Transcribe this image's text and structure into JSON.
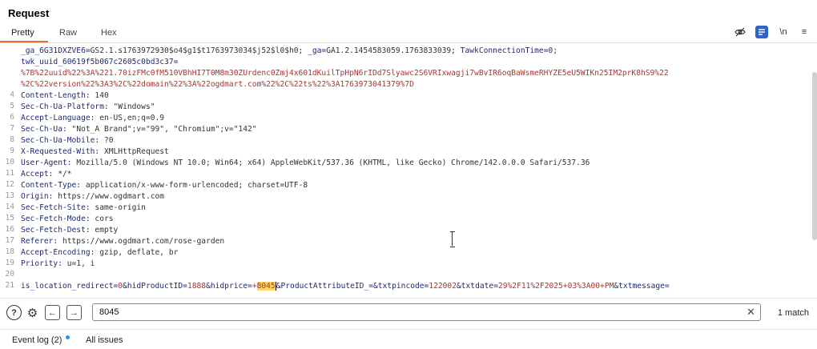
{
  "panel": {
    "title": "Request"
  },
  "tabs": [
    "Pretty",
    "Raw",
    "Hex"
  ],
  "toolbar": {
    "newline_label": "\\n",
    "menu_label": "≡"
  },
  "editor": {
    "lines": [
      {
        "num": "",
        "segments": [
          {
            "cls": "cookie-name",
            "t": "_ga_6G31DXZVE6="
          },
          {
            "cls": "hdr-value",
            "t": "GS2.1.s1763972930$o4$g1$t1763973034$j52$l0$h0; "
          },
          {
            "cls": "cookie-name",
            "t": "_ga="
          },
          {
            "cls": "hdr-value",
            "t": "GA1.2.1454583059.1763833039; "
          },
          {
            "cls": "cookie-name",
            "t": "TawkConnectionTime="
          },
          {
            "cls": "hdr-value",
            "t": "0;"
          }
        ]
      },
      {
        "num": "",
        "segments": [
          {
            "cls": "cookie-name",
            "t": "twk_uuid_60619f5b067c2605c0bd3c37="
          }
        ]
      },
      {
        "num": "",
        "segments": [
          {
            "cls": "cookie-val",
            "t": "%7B%22uuid%22%3A%221.70izFMc0fM510VBhHI7T0M8m30ZUrdenc0Zmj4x601dKuilTpHpN6rIDd7Slyawc2S6VRIxwagji7wBvIR6oqBaWsmeRHYZE5eU5WIKn25IM2prK8hS9%22"
          }
        ]
      },
      {
        "num": "",
        "segments": [
          {
            "cls": "cookie-val",
            "t": "%2C%22version%22%3A3%2C%22domain%22%3A%22ogdmart.com%22%2C%22ts%22%3A1763973041379%7D"
          }
        ]
      },
      {
        "num": "4",
        "segments": [
          {
            "cls": "hdr-name",
            "t": "Content-Length: "
          },
          {
            "cls": "hdr-value",
            "t": "140"
          }
        ]
      },
      {
        "num": "5",
        "segments": [
          {
            "cls": "hdr-name",
            "t": "Sec-Ch-Ua-Platform: "
          },
          {
            "cls": "hdr-value",
            "t": "\"Windows\""
          }
        ]
      },
      {
        "num": "6",
        "segments": [
          {
            "cls": "hdr-name",
            "t": "Accept-Language: "
          },
          {
            "cls": "hdr-value",
            "t": "en-US,en;q=0.9"
          }
        ]
      },
      {
        "num": "7",
        "segments": [
          {
            "cls": "hdr-name",
            "t": "Sec-Ch-Ua: "
          },
          {
            "cls": "hdr-value",
            "t": "\"Not_A Brand\";v=\"99\", \"Chromium\";v=\"142\""
          }
        ]
      },
      {
        "num": "8",
        "segments": [
          {
            "cls": "hdr-name",
            "t": "Sec-Ch-Ua-Mobile: "
          },
          {
            "cls": "hdr-value",
            "t": "?0"
          }
        ]
      },
      {
        "num": "9",
        "segments": [
          {
            "cls": "hdr-name",
            "t": "X-Requested-With: "
          },
          {
            "cls": "hdr-value",
            "t": "XMLHttpRequest"
          }
        ]
      },
      {
        "num": "10",
        "segments": [
          {
            "cls": "hdr-name",
            "t": "User-Agent: "
          },
          {
            "cls": "hdr-value",
            "t": "Mozilla/5.0 (Windows NT 10.0; Win64; x64) AppleWebKit/537.36 (KHTML, like Gecko) Chrome/142.0.0.0 Safari/537.36"
          }
        ]
      },
      {
        "num": "11",
        "segments": [
          {
            "cls": "hdr-name",
            "t": "Accept: "
          },
          {
            "cls": "hdr-value",
            "t": "*/*"
          }
        ]
      },
      {
        "num": "12",
        "segments": [
          {
            "cls": "hdr-name",
            "t": "Content-Type: "
          },
          {
            "cls": "hdr-value",
            "t": "application/x-www-form-urlencoded; charset=UTF-8"
          }
        ]
      },
      {
        "num": "13",
        "segments": [
          {
            "cls": "hdr-name",
            "t": "Origin: "
          },
          {
            "cls": "hdr-value",
            "t": "https://www.ogdmart.com"
          }
        ]
      },
      {
        "num": "14",
        "segments": [
          {
            "cls": "hdr-name",
            "t": "Sec-Fetch-Site: "
          },
          {
            "cls": "hdr-value",
            "t": "same-origin"
          }
        ]
      },
      {
        "num": "15",
        "segments": [
          {
            "cls": "hdr-name",
            "t": "Sec-Fetch-Mode: "
          },
          {
            "cls": "hdr-value",
            "t": "cors"
          }
        ]
      },
      {
        "num": "16",
        "segments": [
          {
            "cls": "hdr-name",
            "t": "Sec-Fetch-Dest: "
          },
          {
            "cls": "hdr-value",
            "t": "empty"
          }
        ]
      },
      {
        "num": "17",
        "segments": [
          {
            "cls": "hdr-name",
            "t": "Referer: "
          },
          {
            "cls": "hdr-value",
            "t": "https://www.ogdmart.com/rose-garden"
          }
        ]
      },
      {
        "num": "18",
        "segments": [
          {
            "cls": "hdr-name",
            "t": "Accept-Encoding: "
          },
          {
            "cls": "hdr-value",
            "t": "gzip, deflate, br"
          }
        ]
      },
      {
        "num": "19",
        "segments": [
          {
            "cls": "hdr-name",
            "t": "Priority: "
          },
          {
            "cls": "hdr-value",
            "t": "u=1, i"
          }
        ]
      },
      {
        "num": "20",
        "segments": []
      },
      {
        "num": "21",
        "segments": [
          {
            "cls": "body-key",
            "t": "is_location_redirect="
          },
          {
            "cls": "body-val",
            "t": "0"
          },
          {
            "cls": "body-key",
            "t": "&hidProductID="
          },
          {
            "cls": "body-val",
            "t": "1888"
          },
          {
            "cls": "body-key",
            "t": "&hidprice="
          },
          {
            "cls": "body-val",
            "t": "+"
          },
          {
            "cls": "hl",
            "t": "8045"
          },
          {
            "cls": "body-key caret-mark",
            "t": "&ProductAttributeID_="
          },
          {
            "cls": "body-key",
            "t": "&txtpincode="
          },
          {
            "cls": "body-val",
            "t": "122002"
          },
          {
            "cls": "body-key",
            "t": "&txtdate="
          },
          {
            "cls": "body-val",
            "t": "29%2F11%2F2025+03%3A00+PM"
          },
          {
            "cls": "body-key",
            "t": "&txtmessage="
          }
        ]
      }
    ]
  },
  "search": {
    "value": "8045",
    "clear_label": "✕",
    "match_count": "1 match",
    "help_label": "?",
    "settings_label": "⚙",
    "prev_label": "←",
    "next_label": "→"
  },
  "footer": {
    "event_log": "Event log (2)",
    "all_issues": "All issues"
  }
}
